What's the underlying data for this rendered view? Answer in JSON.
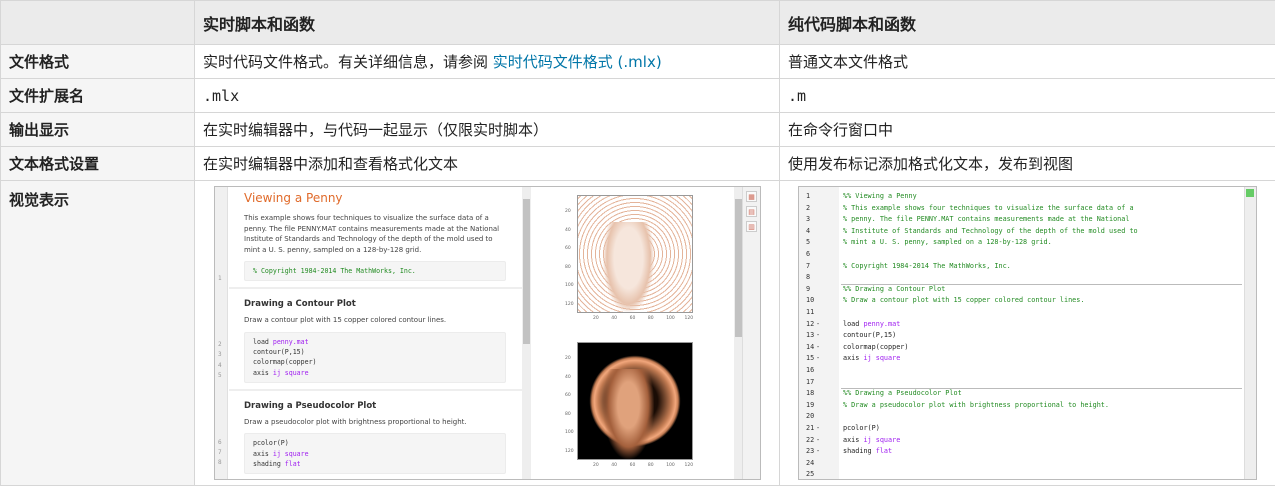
{
  "header": {
    "col0": "",
    "col1": "实时脚本和函数",
    "col2": "纯代码脚本和函数"
  },
  "rows": [
    {
      "label": "文件格式",
      "live": "实时代码文件格式。有关详细信息，请参阅 ",
      "live_link": "实时代码文件格式 (.mlx)",
      "plain": "普通文本文件格式"
    },
    {
      "label": "文件扩展名",
      "live": ".mlx",
      "plain": ".m"
    },
    {
      "label": "输出显示",
      "live": "在实时编辑器中，与代码一起显示（仅限实时脚本）",
      "plain": "在命令行窗口中"
    },
    {
      "label": "文本格式设置",
      "live": "在实时编辑器中添加和查看格式化文本",
      "plain": "使用发布标记添加格式化文本，发布到视图"
    },
    {
      "label": "视觉表示"
    }
  ],
  "live_editor": {
    "title": "Viewing a Penny",
    "intro": "This example shows four techniques to visualize the surface data of a penny. The file PENNY.MAT contains measurements made at the National Institute of Standards and Technology of the depth of the mold used to mint a U. S. penny, sampled on a 128-by-128 grid.",
    "copyright": "% Copyright 1984-2014 The MathWorks, Inc.",
    "s2_title": "Drawing a Contour Plot",
    "s2_text": "Draw a contour plot with 15 copper colored contour lines.",
    "s2_code": [
      "load ",
      "penny.mat",
      "contour(P,15)",
      "colormap(copper)",
      "axis ",
      "ij square"
    ],
    "s3_title": "Drawing a Pseudocolor Plot",
    "s3_text": "Draw a pseudocolor plot with brightness proportional to height.",
    "s3_code": [
      "pcolor(P)",
      "axis ",
      "ij square",
      "shading ",
      "flat"
    ],
    "line_numbers": [
      "1",
      "2",
      "3",
      "4",
      "5",
      "6",
      "7",
      "8"
    ],
    "yticks": [
      "20",
      "40",
      "60",
      "80",
      "100",
      "120"
    ],
    "xticks": [
      "20",
      "40",
      "60",
      "80",
      "100",
      "120"
    ]
  },
  "plain_editor": {
    "lines": [
      {
        "n": "1",
        "t": "%% Viewing a Penny",
        "k": "c"
      },
      {
        "n": "2",
        "t": "% This example shows four techniques to visualize the surface data of a",
        "k": "c"
      },
      {
        "n": "3",
        "t": "% penny. The file PENNY.MAT contains measurements made at the National",
        "k": "c"
      },
      {
        "n": "4",
        "t": "% Institute of Standards and Technology of the depth of the mold used to",
        "k": "c"
      },
      {
        "n": "5",
        "t": "% mint a U. S. penny, sampled on a 128-by-128 grid.",
        "k": "c"
      },
      {
        "n": "6",
        "t": "",
        "k": ""
      },
      {
        "n": "7",
        "t": "% Copyright 1984-2014 The MathWorks, Inc.",
        "k": "c"
      },
      {
        "n": "8",
        "t": "",
        "k": ""
      },
      {
        "n": "9",
        "t": "%% Drawing a Contour Plot",
        "k": "c"
      },
      {
        "n": "10",
        "t": "% Draw a contour plot with 15 copper colored contour lines.",
        "k": "c"
      },
      {
        "n": "11",
        "t": "",
        "k": ""
      },
      {
        "n": "12",
        "t": "load ",
        "s": "penny.mat",
        "k": "x",
        "dash": "-"
      },
      {
        "n": "13",
        "t": "contour(P,15)",
        "k": "x",
        "dash": "-"
      },
      {
        "n": "14",
        "t": "colormap(copper)",
        "k": "x",
        "dash": "-"
      },
      {
        "n": "15",
        "t": "axis ",
        "s": "ij square",
        "k": "x",
        "dash": "-"
      },
      {
        "n": "16",
        "t": "",
        "k": ""
      },
      {
        "n": "17",
        "t": "",
        "k": ""
      },
      {
        "n": "18",
        "t": "%% Drawing a Pseudocolor Plot",
        "k": "c"
      },
      {
        "n": "19",
        "t": "% Draw a pseudocolor plot with brightness proportional to height.",
        "k": "c"
      },
      {
        "n": "20",
        "t": "",
        "k": ""
      },
      {
        "n": "21",
        "t": "pcolor(P)",
        "k": "x",
        "dash": "-"
      },
      {
        "n": "22",
        "t": "axis ",
        "s": "ij square",
        "k": "x",
        "dash": "-"
      },
      {
        "n": "23",
        "t": "shading ",
        "s": "flat",
        "k": "x",
        "dash": "-"
      },
      {
        "n": "24",
        "t": "",
        "k": ""
      },
      {
        "n": "25",
        "t": "",
        "k": ""
      }
    ]
  },
  "colors": {
    "link": "#0076a8",
    "comment": "#228b22",
    "string": "#a020f0",
    "title": "#e06a2a"
  }
}
